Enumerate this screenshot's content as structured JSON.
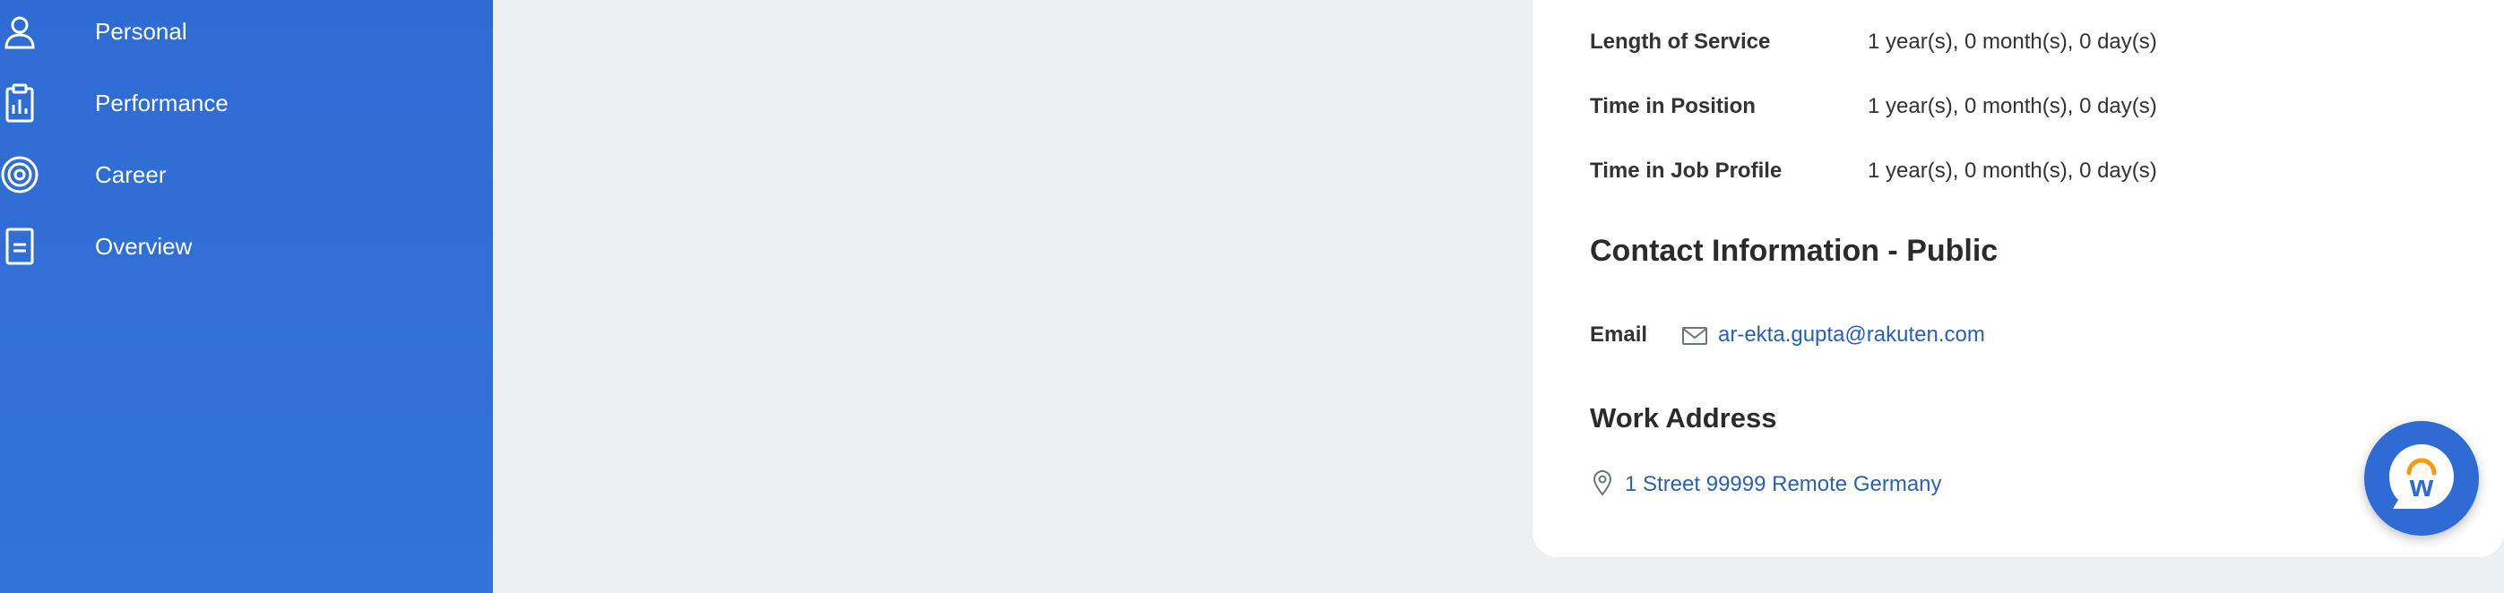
{
  "sidebar": {
    "items": [
      {
        "label": "Personal",
        "icon": "person-icon"
      },
      {
        "label": "Performance",
        "icon": "clipboard-chart-icon"
      },
      {
        "label": "Career",
        "icon": "target-icon"
      },
      {
        "label": "Overview",
        "icon": "document-icon"
      }
    ]
  },
  "details": {
    "rows": [
      {
        "label": "Length of Service",
        "value": "1 year(s), 0 month(s), 0 day(s)"
      },
      {
        "label": "Time in Position",
        "value": "1 year(s), 0 month(s), 0 day(s)"
      },
      {
        "label": "Time in Job Profile",
        "value": "1 year(s), 0 month(s), 0 day(s)"
      }
    ]
  },
  "contact": {
    "heading": "Contact Information - Public",
    "email_label": "Email",
    "email": "ar-ekta.gupta@rakuten.com"
  },
  "work_address": {
    "heading": "Work Address",
    "address": "1 Street 99999 Remote Germany"
  },
  "chat": {
    "logo_letter": "w"
  },
  "colors": {
    "sidebar": "#2f6bd4",
    "link": "#2a5fb8",
    "background": "#eeeff1",
    "accent": "#f39c12"
  }
}
